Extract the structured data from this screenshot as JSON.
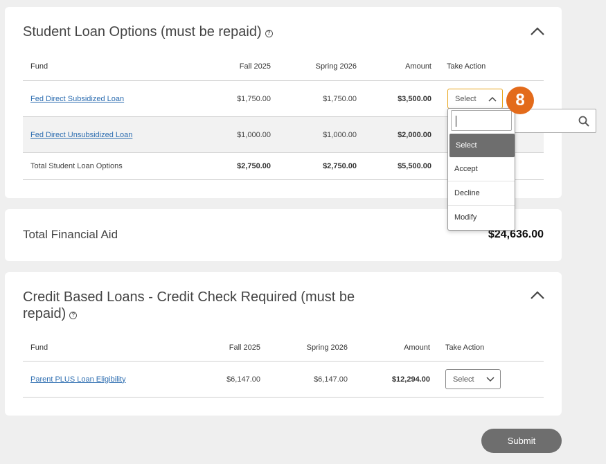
{
  "student_loans": {
    "title": "Student Loan Options (must be repaid)",
    "headers": {
      "fund": "Fund",
      "fall": "Fall 2025",
      "spring": "Spring 2026",
      "amount": "Amount",
      "action": "Take Action"
    },
    "rows": [
      {
        "fund": "Fed Direct Subsidized Loan",
        "fall": "$1,750.00",
        "spring": "$1,750.00",
        "amount": "$3,500.00",
        "action": "Select"
      },
      {
        "fund": "Fed Direct Unsubsidized Loan",
        "fall": "$1,000.00",
        "spring": "$1,000.00",
        "amount": "$2,000.00"
      }
    ],
    "total_row": {
      "label": "Total Student Loan Options",
      "fall": "$2,750.00",
      "spring": "$2,750.00",
      "amount": "$5,500.00"
    }
  },
  "dropdown": {
    "options": [
      "Select",
      "Accept",
      "Decline",
      "Modify"
    ],
    "selected": "Select"
  },
  "step_badge": "8",
  "total_aid": {
    "label": "Total Financial Aid",
    "value": "$24,636.00"
  },
  "credit_loans": {
    "title_line1": "Credit Based Loans - Credit Check Required (must be",
    "title_line2": "repaid)",
    "headers": {
      "fund": "Fund",
      "fall": "Fall 2025",
      "spring": "Spring 2026",
      "amount": "Amount",
      "action": "Take Action"
    },
    "rows": [
      {
        "fund": "Parent PLUS Loan Eligibility",
        "fall": "$6,147.00",
        "spring": "$6,147.00",
        "amount": "$12,294.00",
        "action": "Select"
      }
    ]
  },
  "submit_label": "Submit",
  "colors": {
    "badge": "#e36b1b",
    "link": "#2b6cb0",
    "button": "#6e6e6e",
    "focus": "#e8a317"
  }
}
